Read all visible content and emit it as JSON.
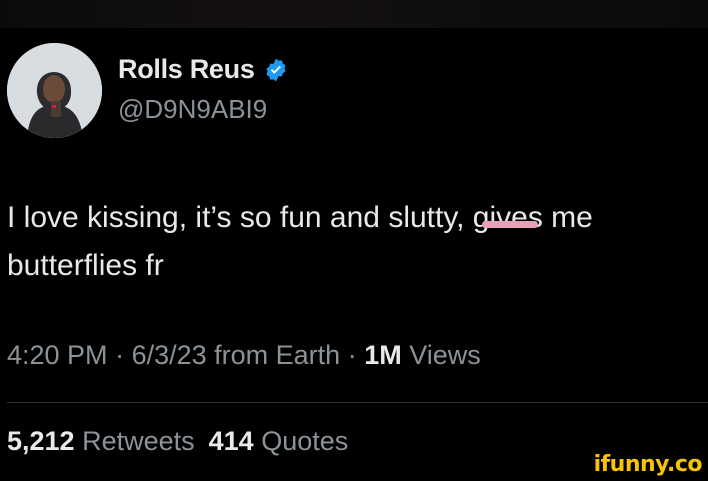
{
  "author": {
    "name": "Rolls Reus",
    "handle": "@D9N9ABI9",
    "verified": true,
    "avatar_icon": "avatar-photo"
  },
  "tweet": {
    "line1_before": "I love kissing, it’s so fun and s",
    "line1_censored": "lutty",
    "line1_after": ", gives me",
    "line2": "butterflies fr"
  },
  "meta": {
    "time": "4:20 PM",
    "sep1": " · ",
    "date": "6/3/23",
    "source": " from Earth",
    "sep2": " · ",
    "views_count": "1M",
    "views_label": " Views"
  },
  "stats": {
    "retweets_count": "5,212",
    "retweets_label": " Retweets",
    "quotes_count": "414",
    "quotes_label": " Quotes"
  },
  "watermark": "ifunny.co",
  "colors": {
    "background": "#000000",
    "text": "#e7e9ea",
    "muted": "#8b9298",
    "verified": "#1d9bf0",
    "censor": "#e8a0b8",
    "watermark": "#f7c400"
  }
}
